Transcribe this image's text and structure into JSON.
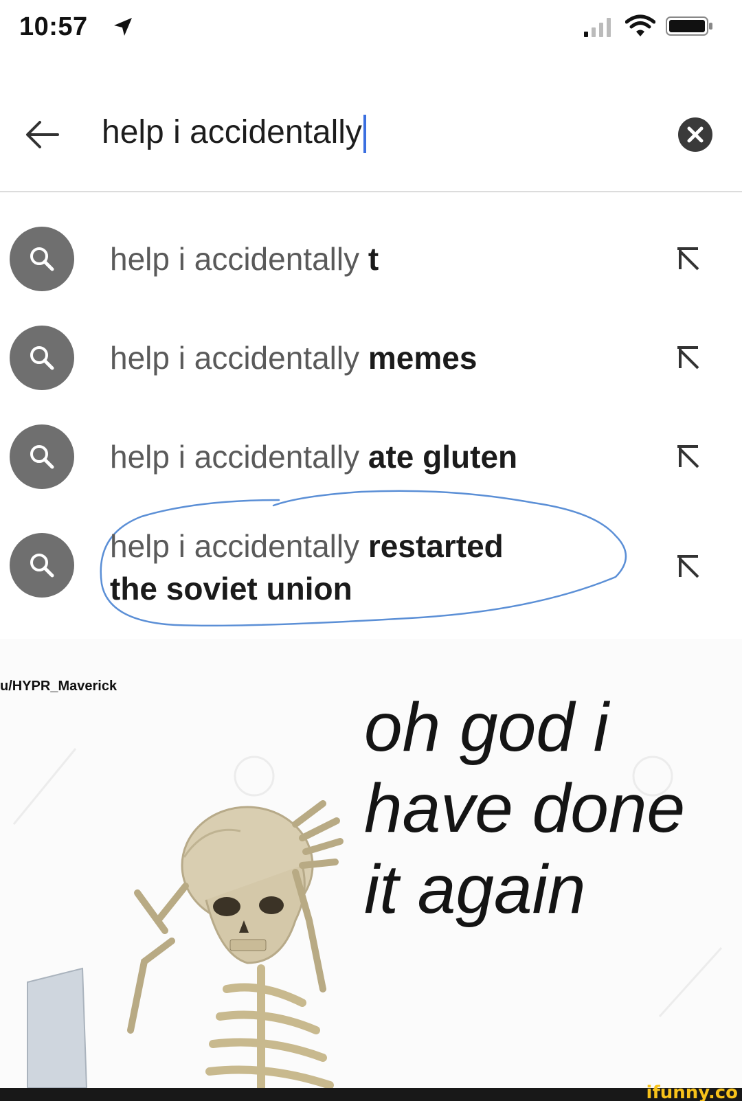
{
  "status_bar": {
    "time": "10:57",
    "icons": [
      "location-arrow-icon",
      "signal-icon",
      "wifi-icon",
      "battery-icon"
    ]
  },
  "search": {
    "back_icon": "arrow-left-icon",
    "query": "help i accidentally",
    "clear_icon": "clear-circle-icon",
    "accent_color": "#3b6fe0"
  },
  "suggestions": [
    {
      "prefix": "help i accidentally",
      "suffix": "t",
      "icon": "search-icon",
      "fill_icon": "arrow-up-left-icon"
    },
    {
      "prefix": "help i accidentally",
      "suffix": "memes",
      "icon": "search-icon",
      "fill_icon": "arrow-up-left-icon"
    },
    {
      "prefix": "help i accidentally",
      "suffix": "ate gluten",
      "icon": "search-icon",
      "fill_icon": "arrow-up-left-icon"
    },
    {
      "prefix": "help i accidentally",
      "suffix": "restarted",
      "suffix_line2": "the soviet union",
      "icon": "search-icon",
      "fill_icon": "arrow-up-left-icon",
      "circled": true
    }
  ],
  "meme": {
    "username": "u/HYPR_Maverick",
    "caption_lines": [
      "oh god i",
      "have done",
      "it again"
    ]
  },
  "footer": {
    "logo": "ifunny.co",
    "logo_color": "#f7c21a"
  }
}
